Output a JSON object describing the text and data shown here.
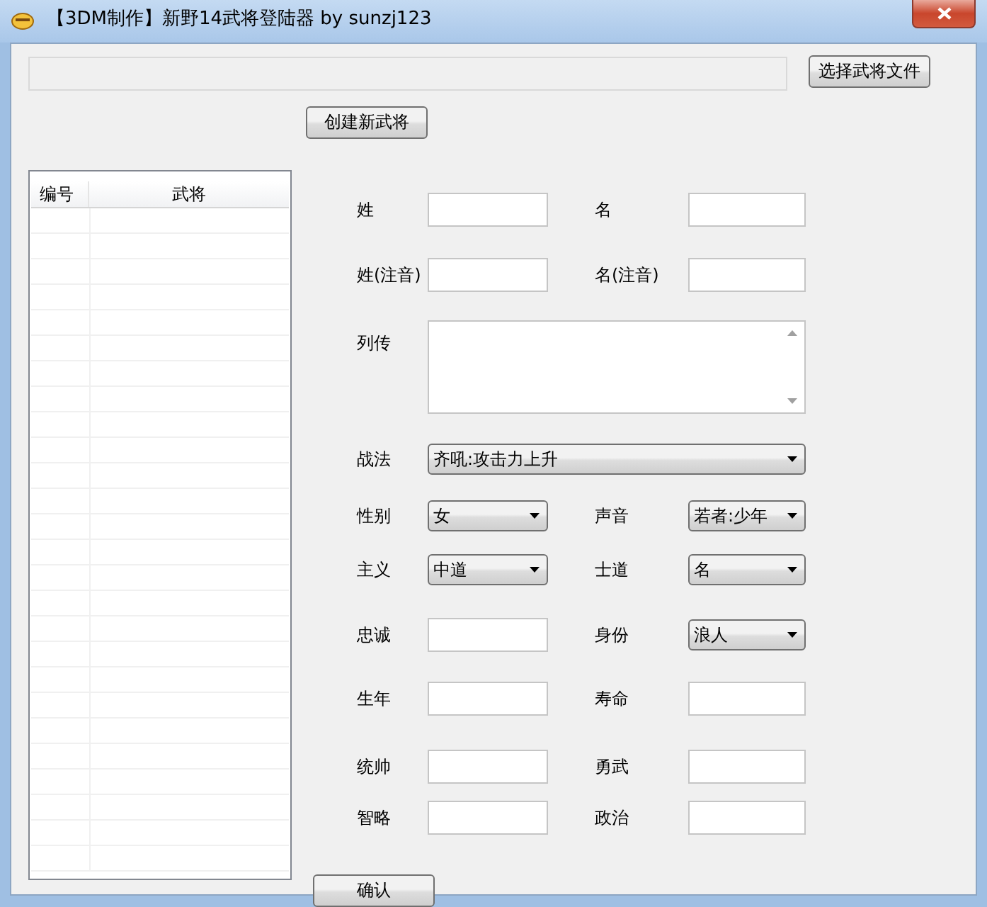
{
  "window": {
    "title": "【3DM制作】新野14武将登陆器 by sunzj123"
  },
  "file_bar": {
    "button": "选择武将文件"
  },
  "create_button": "创建新武将",
  "general_list": {
    "columns": [
      "编号",
      "武将"
    ]
  },
  "form": {
    "rows": [
      [
        {
          "label": "姓",
          "kind": "text"
        },
        {
          "label": "名",
          "kind": "text"
        }
      ],
      [
        {
          "label": "姓(注音)",
          "kind": "text"
        },
        {
          "label": "名(注音)",
          "kind": "text"
        }
      ],
      [
        {
          "label": "列传",
          "kind": "textarea"
        }
      ],
      [
        {
          "label": "战法",
          "kind": "select",
          "value": "齐吼:攻击力上升"
        }
      ],
      [
        {
          "label": "性别",
          "kind": "select",
          "value": "女"
        },
        {
          "label": "声音",
          "kind": "select",
          "value": "若者:少年"
        }
      ],
      [
        {
          "label": "主义",
          "kind": "select",
          "value": "中道"
        },
        {
          "label": "士道",
          "kind": "select",
          "value": "名"
        }
      ],
      [
        {
          "label": "忠诚",
          "kind": "text"
        },
        {
          "label": "身份",
          "kind": "select",
          "value": "浪人"
        }
      ],
      [
        {
          "label": "生年",
          "kind": "text"
        },
        {
          "label": "寿命",
          "kind": "text"
        }
      ],
      [
        {
          "label": "统帅",
          "kind": "text"
        },
        {
          "label": "勇武",
          "kind": "text"
        }
      ],
      [
        {
          "label": "智略",
          "kind": "text"
        },
        {
          "label": "政治",
          "kind": "text"
        }
      ]
    ],
    "confirm": "确认"
  }
}
